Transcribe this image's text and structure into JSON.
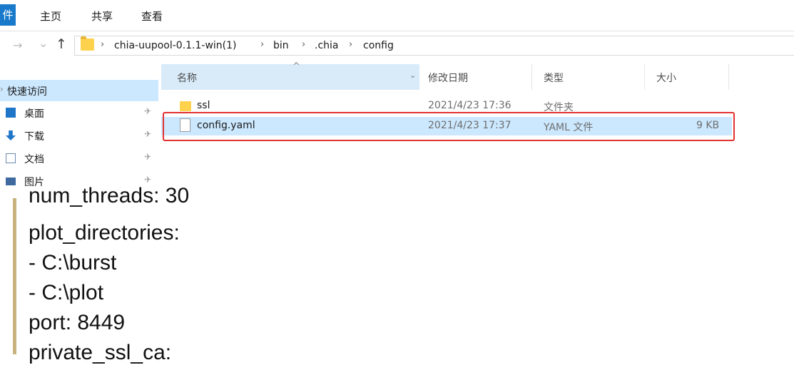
{
  "ribbon": {
    "file_tab": "件",
    "tabs": [
      "主页",
      "共享",
      "查看"
    ]
  },
  "address": {
    "back_glyph": "→",
    "dropdown_glyph": "⌄",
    "up_glyph": "↑",
    "crumbs": [
      "chia-uupool-0.1.1-win(1)",
      "bin",
      ".chia",
      "config"
    ]
  },
  "nav_pane": {
    "quick_access": "快速访问",
    "items": [
      {
        "label": "桌面",
        "icon": "desktop-icon",
        "color": "#1f75c8"
      },
      {
        "label": "下载",
        "icon": "download-icon",
        "color": "#1f75c8"
      },
      {
        "label": "文档",
        "icon": "document-icon",
        "color": "#6b8bb0"
      },
      {
        "label": "图片",
        "icon": "pictures-icon",
        "color": "#3f6aa0"
      }
    ],
    "pin_glyph": "✈"
  },
  "file_list": {
    "columns": {
      "name": "名称",
      "date": "修改日期",
      "type": "类型",
      "size": "大小"
    },
    "rows": [
      {
        "name": "ssl",
        "date": "2021/4/23 17:36",
        "type": "文件夹",
        "size": "",
        "icon": "folder-icon"
      },
      {
        "name": "config.yaml",
        "date": "2021/4/23 17:37",
        "type": "YAML 文件",
        "size": "9 KB",
        "icon": "file-icon"
      }
    ]
  },
  "overlay_text": {
    "partial_top": "num_threads: 30",
    "lines": [
      "plot_directories:",
      "- C:\\burst",
      "- C:\\plot",
      "port: 8449"
    ],
    "partial_bottom": "private_ssl_ca:"
  },
  "colors": {
    "selection": "#cce8ff",
    "highlight_border": "#e23232",
    "folder": "#ffd24d"
  }
}
